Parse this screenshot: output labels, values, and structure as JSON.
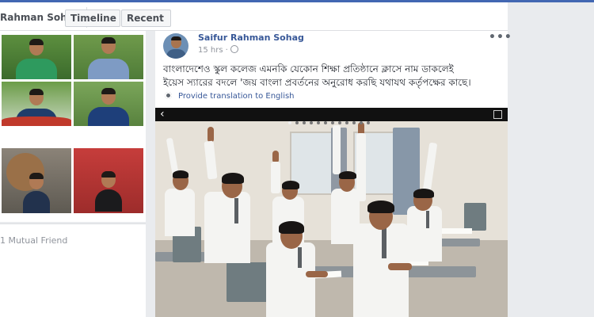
{
  "profile": {
    "name": "Rahman Sohag",
    "tabs": [
      {
        "label": "Timeline"
      },
      {
        "label": "Recent"
      }
    ]
  },
  "friends": {
    "mutual_label": "1 Mutual Friend"
  },
  "post": {
    "author": "Saifur Rahman Sohag",
    "time": "15 hrs",
    "privacy_icon": "globe-icon",
    "text_line1": "বাংলাদেশেও স্কুল কলেজ এমনকি যেকোন শিক্ষা প্রতিষ্ঠানে ক্লাসে নাম ডাকলেই",
    "text_line2": "ইয়েস স্যারের বদলে 'জয় বাংলা প্রবর্তনের অনুরোধ করছি যথাযথ কর্তৃপক্ষের কাছে।",
    "translate_label": "Provide translation to English",
    "more_icon": "•••",
    "photo_back_icon": "‹"
  },
  "colors": {
    "link": "#385898",
    "brand_bar": "#4267b2",
    "background": "#e9ebee"
  }
}
